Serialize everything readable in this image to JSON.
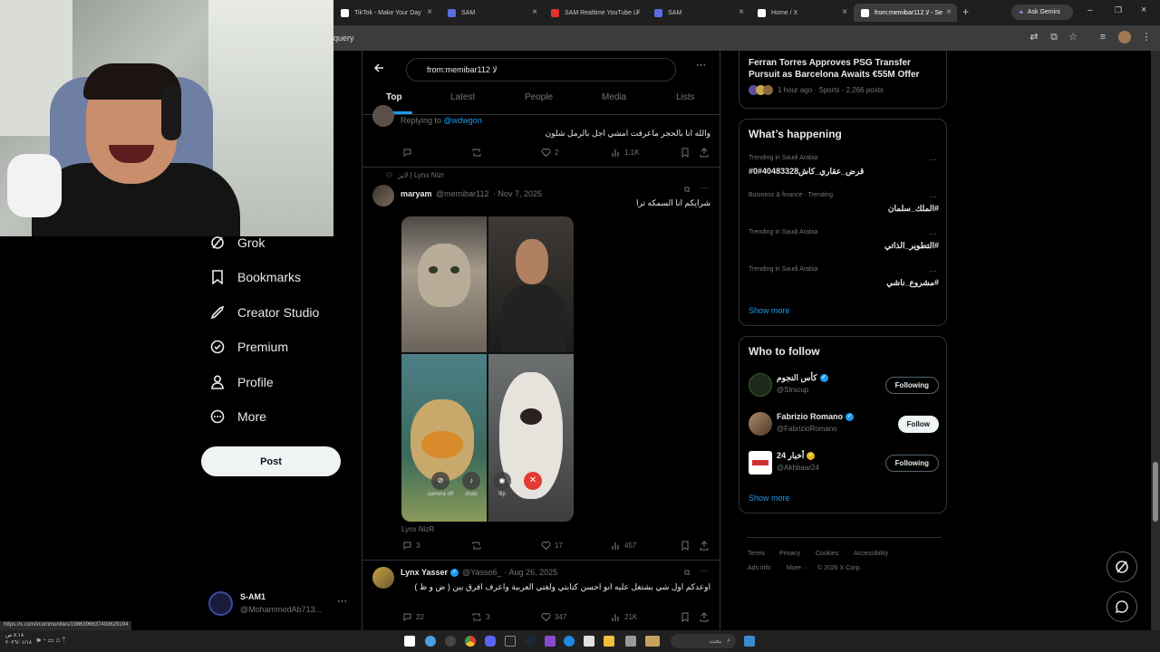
{
  "browser": {
    "tabs": [
      {
        "title": "TikTok - Make Your Day",
        "fav_color": "#ffffff"
      },
      {
        "title": "SAM",
        "fav_color": "#5b6ee1"
      },
      {
        "title": "SAM Realtime YouTube Li",
        "fav_color": "#e03131"
      },
      {
        "title": "SAM",
        "fav_color": "#5b6ee1"
      },
      {
        "title": "Home / X",
        "fav_color": "#ffffff"
      },
      {
        "title": "from:memibar112 لا - Se",
        "fav_color": "#ffffff"
      }
    ],
    "ask_gemini": "Ask Gemini",
    "url_fragment": "query",
    "status_url": "https://x.com/i/communities/1986396637493629194"
  },
  "nav": {
    "items": [
      {
        "label": "Grok",
        "icon": "grok-icon"
      },
      {
        "label": "Bookmarks",
        "icon": "bookmark-icon"
      },
      {
        "label": "Creator Studio",
        "icon": "rocket-icon"
      },
      {
        "label": "Premium",
        "icon": "premium-icon"
      },
      {
        "label": "Profile",
        "icon": "person-icon"
      },
      {
        "label": "More",
        "icon": "more-circle-icon"
      }
    ],
    "post_label": "Post",
    "account": {
      "name": "S-AM1",
      "handle": "@MohammedAb713..."
    }
  },
  "search": {
    "value": "from:memibar112 لا",
    "tabs": [
      "Top",
      "Latest",
      "People",
      "Media",
      "Lists"
    ],
    "active_tab": "Top"
  },
  "tweets": [
    {
      "replying_prefix": "Replying to",
      "replying_to": "@wdwgon",
      "text": "والله انا بالحجر ماعرفت امشي اجل بالرمل شلون",
      "replies": "",
      "retweets": "",
      "likes": "2",
      "views": "1.1K"
    },
    {
      "community": "لايز | Lynx Nizr",
      "name": "maryam",
      "handle": "@memibar112",
      "date": "· Nov 7, 2025",
      "text": "شرايكم انا السمكه ترا",
      "media_caption": "Lynx NizR",
      "call_controls": [
        {
          "label": "camera off",
          "icon": "camera-off-icon"
        },
        {
          "label": "mute",
          "icon": "mic-icon"
        },
        {
          "label": "flip",
          "icon": "camera-icon"
        },
        {
          "label": "end",
          "icon": "end-call-icon"
        }
      ],
      "replies": "3",
      "retweets": "",
      "likes": "17",
      "views": "457"
    },
    {
      "name": "Lynx Yasser",
      "handle": "@Yasso6_",
      "date": "· Aug 26, 2025",
      "text": "اوعدكم اول شي بشتغل عليه انو احسن كتابتي ولغتي العربية واعرف افرق بين ( ض و ظ )",
      "replies": "22",
      "retweets": "3",
      "likes": "347",
      "views": "21K"
    }
  ],
  "right": {
    "news": {
      "title": "Ferran Torres Approves PSG Transfer Pursuit as Barcelona Awaits €55M Offer",
      "meta": "1 hour ago · Sports · 2,266 posts"
    },
    "happening": {
      "heading": "What’s happening",
      "trends": [
        {
          "category": "Trending in Saudi Arabia",
          "tag": "#قرض_عقاري_كاش40483328#0"
        },
        {
          "category": "Business & finance · Trending",
          "tag": "#الملك_سلمان"
        },
        {
          "category": "Trending in Saudi Arabia",
          "tag": "#التطوير_الذاتي"
        },
        {
          "category": "Trending in Saudi Arabia",
          "tag": "#مشروع_ناشي"
        }
      ],
      "show_more": "Show more"
    },
    "who_to_follow": {
      "heading": "Who to follow",
      "accounts": [
        {
          "name": "كأس النجوم",
          "handle": "@Strscup",
          "button": "Following",
          "badge": "blue"
        },
        {
          "name": "Fabrizio Romano",
          "handle": "@FabrizioRomano",
          "button": "Follow",
          "badge": "blue"
        },
        {
          "name": "أخبار 24",
          "handle": "@Akhbaar24",
          "button": "Following",
          "badge": "gold"
        }
      ],
      "show_more": "Show more"
    },
    "footer": {
      "links": [
        "Terms",
        "Privacy",
        "Cookies",
        "Accessibility",
        "Ads info",
        "More ···"
      ],
      "copyright": "© 2026 X Corp."
    }
  },
  "taskbar": {
    "search_placeholder": "بحث",
    "clock": "٨:١٨ ص",
    "date": "٢٠٢٦/٠١/١٨"
  },
  "colors": {
    "accent": "#1d9bf0",
    "background": "#000000",
    "border": "#2f3336",
    "muted": "#71767b"
  }
}
